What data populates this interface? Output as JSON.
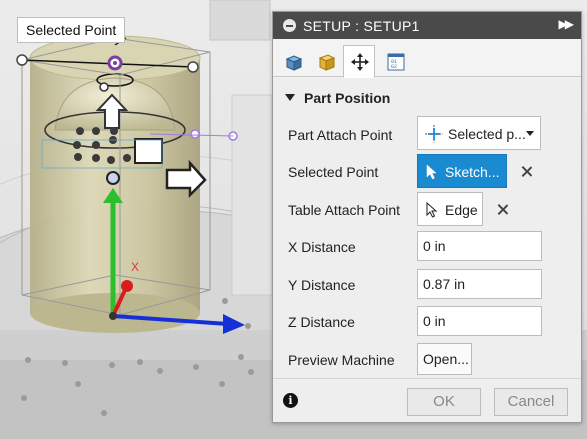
{
  "viewport": {
    "callout_label": "Selected Point",
    "axis_label": "X"
  },
  "dialog": {
    "title": "SETUP : SETUP1",
    "tabs": [
      {
        "icon": "setup-icon"
      },
      {
        "icon": "stock-icon"
      },
      {
        "icon": "move-icon",
        "active": true
      },
      {
        "icon": "post-process-icon"
      }
    ],
    "section": {
      "header": "Part Position",
      "rows": {
        "part_attach_point": {
          "label": "Part Attach Point",
          "value": "Selected p..."
        },
        "selected_point": {
          "label": "Selected Point",
          "value": "Sketch..."
        },
        "table_attach_point": {
          "label": "Table Attach Point",
          "value": "Edge"
        },
        "x_distance": {
          "label": "X Distance",
          "value": "0 in"
        },
        "y_distance": {
          "label": "Y Distance",
          "value": "0.87 in"
        },
        "z_distance": {
          "label": "Z Distance",
          "value": "0 in"
        },
        "preview_machine": {
          "label": "Preview Machine",
          "value": "Open..."
        }
      }
    },
    "footer": {
      "ok_label": "OK",
      "cancel_label": "Cancel"
    }
  },
  "colors": {
    "titlebar": "#4a4a4a",
    "selection_blue": "#1a8bd1",
    "axis_green": "#2bc02b",
    "axis_blue": "#1530d8",
    "axis_red": "#d91d1d",
    "part_tan": "#cfc9a3"
  }
}
